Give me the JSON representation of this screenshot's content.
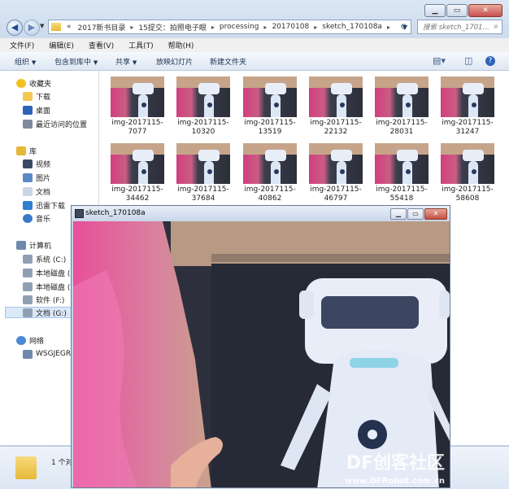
{
  "explorer": {
    "address": {
      "overflow": "«",
      "segments": [
        "2017新书目录",
        "15提交：拍照电子眼",
        "processing",
        "20170108",
        "sketch_170108a"
      ],
      "search_placeholder": "搜索 sketch_1701..."
    },
    "menu": [
      "文件(F)",
      "编辑(E)",
      "查看(V)",
      "工具(T)",
      "帮助(H)"
    ],
    "toolbar": {
      "organize": "组织",
      "include": "包含到库中",
      "share": "共享",
      "slideshow": "放映幻灯片",
      "new_folder": "新建文件夹"
    },
    "nav": {
      "favorites": "收藏夹",
      "downloads": "下载",
      "desktop": "桌面",
      "recent": "最近访问的位置",
      "libraries": "库",
      "videos": "视频",
      "pictures": "图片",
      "documents": "文档",
      "thunder": "迅雷下载",
      "music": "音乐",
      "computer": "计算机",
      "drive_c": "系统 (C:)",
      "drive_d": "本地磁盘 (D",
      "drive_e": "本地磁盘 (E",
      "drive_f": "软件 (F:)",
      "drive_g": "文档 (G:)",
      "network": "网络",
      "host": "WSGJEGRA"
    },
    "files": [
      "img-2017115-7077",
      "img-2017115-10320",
      "img-2017115-13519",
      "img-2017115-22132",
      "img-2017115-28031",
      "img-2017115-31247",
      "img-2017115-34462",
      "img-2017115-37684",
      "img-2017115-40862",
      "img-2017115-46797",
      "img-2017115-55418",
      "img-2017115-58608"
    ],
    "status": "1 个对"
  },
  "sketch_window": {
    "title": "sketch_170108a"
  },
  "watermark": {
    "line1": "DF创客社区",
    "line2": "www.DFRobot.com.cn"
  },
  "colors": {
    "accent": "#3b5e8f",
    "pink": "#d23e7e"
  }
}
